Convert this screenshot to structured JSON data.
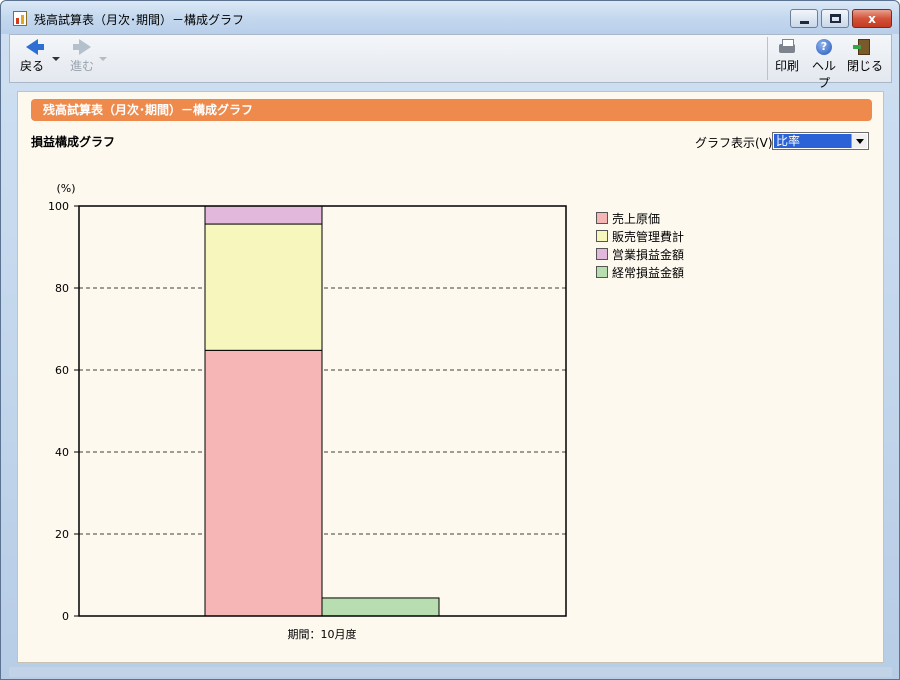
{
  "window": {
    "title": "残高試算表（月次･期間）－構成グラフ",
    "minimize_label": "",
    "maximize_label": "",
    "close_label": "x"
  },
  "toolbar": {
    "back_label": "戻る",
    "forward_label": "進む",
    "print_label": "印刷",
    "help_label": "ヘルプ",
    "close_label": "閉じる",
    "help_icon_glyph": "?"
  },
  "content": {
    "banner_title": "残高試算表（月次･期間）－構成グラフ",
    "section_label": "損益構成グラフ",
    "display_label": "グラフ表示(V):",
    "display_select_value": "比率"
  },
  "colors": {
    "cost_of_sales": "#f7b6b6",
    "sga": "#f6f6bd",
    "operating_profit": "#e2b8dc",
    "ordinary_profit": "#b8ddb0",
    "banner": "#ee8a4c"
  },
  "chart_data": {
    "type": "bar",
    "stacked": true,
    "ylabel": "(%)",
    "ylim": [
      0,
      100
    ],
    "yticks": [
      0,
      20,
      40,
      60,
      80,
      100
    ],
    "grid": true,
    "legend_placement": "right",
    "x_category_label": "期間：10月度",
    "series": [
      {
        "name": "売上原価",
        "values": [
          64.8
        ],
        "column": 0,
        "color": "#f7b6b6"
      },
      {
        "name": "販売管理費計",
        "values": [
          30.8
        ],
        "column": 0,
        "color": "#f6f6bd"
      },
      {
        "name": "営業損益金額",
        "values": [
          4.4
        ],
        "column": 0,
        "color": "#e2b8dc"
      },
      {
        "name": "経常損益金額",
        "values": [
          4.4
        ],
        "column": 1,
        "color": "#b8ddb0"
      }
    ]
  }
}
